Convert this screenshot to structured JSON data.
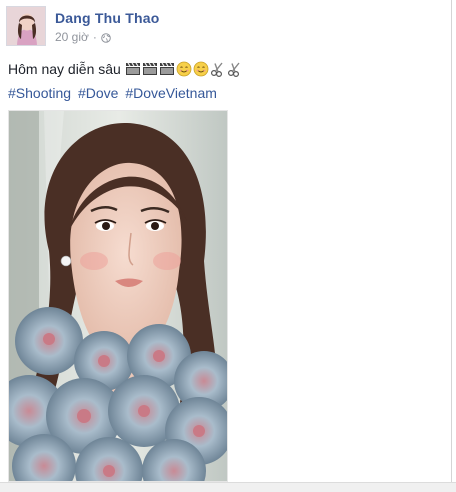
{
  "post": {
    "author": "Dang Thu Thao",
    "time": "20 giờ",
    "separator": "·",
    "privacy_icon": "globe-icon",
    "text": "Hôm nay diễn sâu",
    "emojis": [
      "clapper-board-icon",
      "clapper-board-icon",
      "clapper-board-icon",
      "smiling-face-icon",
      "smiling-face-icon",
      "scissors-icon",
      "scissors-icon"
    ],
    "hashtags": [
      "#Shooting",
      "#Dove",
      "#DoveVietnam"
    ]
  },
  "colors": {
    "author_link": "#3b5998",
    "hashtag_link": "#365899",
    "meta_text": "#90949c",
    "body_text": "#1d2129"
  }
}
